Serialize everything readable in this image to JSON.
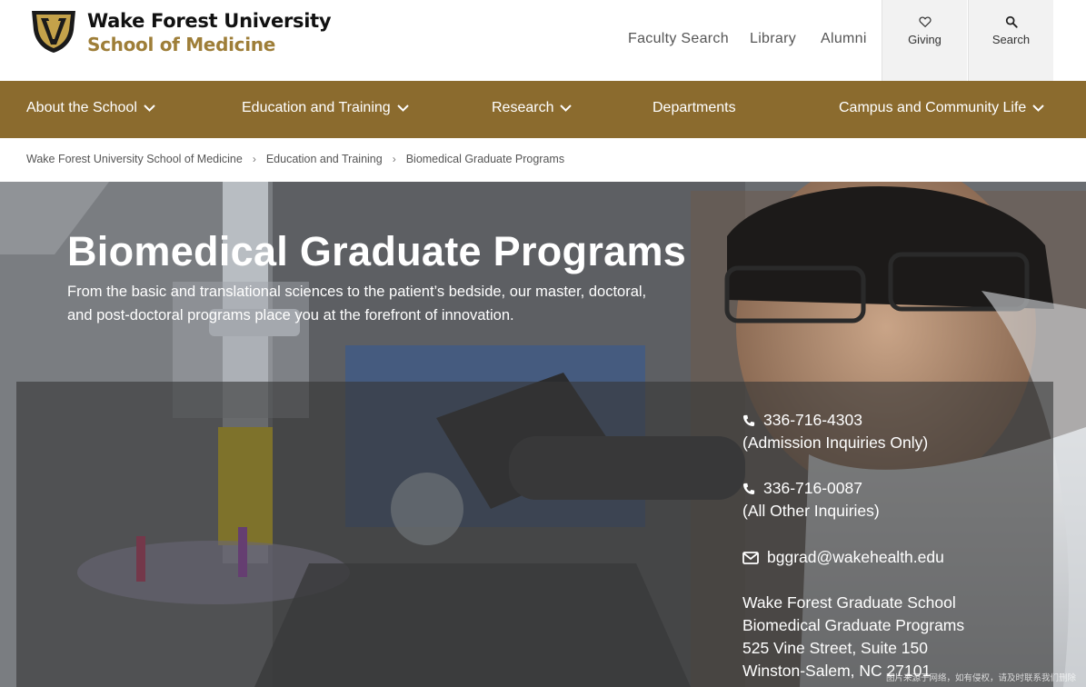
{
  "brand": {
    "line1": "Wake Forest University",
    "line2": "School of Medicine"
  },
  "utility_nav": {
    "links": [
      "Faculty Search",
      "Library",
      "Alumni"
    ],
    "giving": {
      "label": "Giving",
      "icon": "heart-icon"
    },
    "search": {
      "label": "Search",
      "icon": "search-icon"
    }
  },
  "main_nav": {
    "items": [
      {
        "label": "About the School",
        "dropdown": true
      },
      {
        "label": "Education and Training",
        "dropdown": true
      },
      {
        "label": "Research",
        "dropdown": true
      },
      {
        "label": "Departments",
        "dropdown": false
      },
      {
        "label": "Campus and Community Life",
        "dropdown": true
      }
    ]
  },
  "breadcrumb": {
    "items": [
      "Wake Forest University School of Medicine",
      "Education and Training",
      "Biomedical Graduate Programs"
    ],
    "separator": "›"
  },
  "hero": {
    "title": "Biomedical Graduate Programs",
    "subtitle": "From the basic and translational sciences to the patient’s bedside, our master, doctoral, and post-doctoral programs place you at the forefront of innovation."
  },
  "contact": {
    "phone1": "336-716-4303",
    "phone1_note": "(Admission Inquiries Only)",
    "phone2": "336-716-0087",
    "phone2_note": "(All Other Inquiries)",
    "email": "bggrad@wakehealth.edu",
    "address": [
      "Wake Forest Graduate School",
      "Biomedical Graduate Programs",
      "525 Vine Street, Suite 150",
      "Winston-Salem, NC 27101"
    ]
  },
  "watermark": "图片来源于网络，如有侵权，请及时联系我们删除",
  "colors": {
    "brand_gold": "#9e7e38",
    "nav_bg": "#8b6b2e",
    "utility_bg": "#f2f2f2"
  }
}
